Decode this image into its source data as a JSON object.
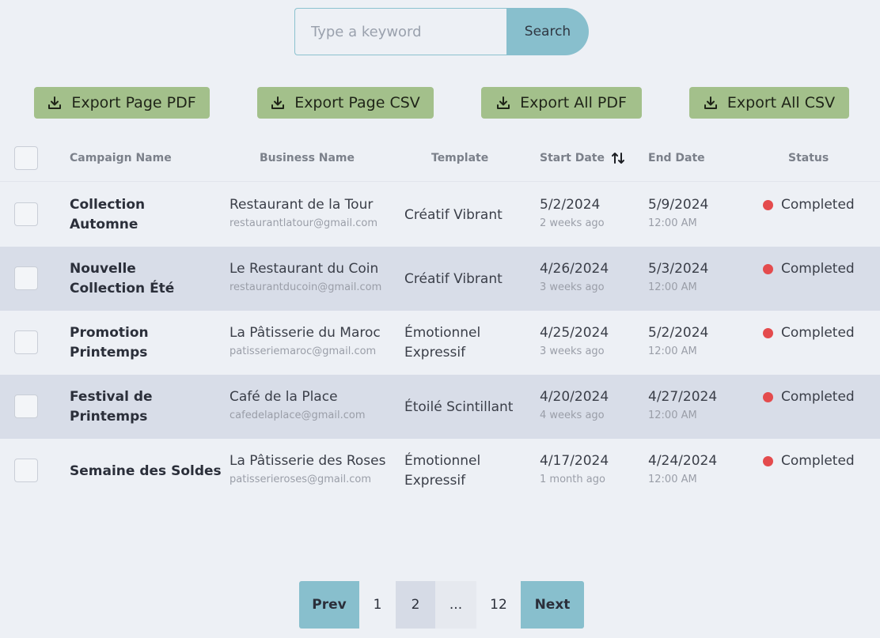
{
  "search": {
    "placeholder": "Type a keyword",
    "value": "",
    "button_label": "Search"
  },
  "exports": [
    {
      "label": "Export Page PDF",
      "icon": "download-icon"
    },
    {
      "label": "Export Page CSV",
      "icon": "download-icon"
    },
    {
      "label": "Export All PDF",
      "icon": "download-icon"
    },
    {
      "label": "Export All CSV",
      "icon": "download-icon"
    }
  ],
  "table": {
    "headers": {
      "campaign": "Campaign Name",
      "business": "Business Name",
      "template": "Template",
      "start": "Start Date",
      "end": "End Date",
      "status": "Status"
    },
    "sort_icon": "sort-arrows-icon",
    "rows": [
      {
        "campaign": "Collection Automne",
        "business": "Restaurant de la Tour",
        "email": "restaurantlatour@gmail.com",
        "template": "Créatif Vibrant",
        "start": "5/2/2024",
        "start_ago": "2 weeks ago",
        "end": "5/9/2024",
        "end_time": "12:00 AM",
        "status": "Completed"
      },
      {
        "campaign": "Nouvelle Collection Été",
        "business": "Le Restaurant du Coin",
        "email": "restaurantducoin@gmail.com",
        "template": "Créatif Vibrant",
        "start": "4/26/2024",
        "start_ago": "3 weeks ago",
        "end": "5/3/2024",
        "end_time": "12:00 AM",
        "status": "Completed"
      },
      {
        "campaign": "Promotion Printemps",
        "business": "La Pâtisserie du Maroc",
        "email": "patisseriemaroc@gmail.com",
        "template": "Émotionnel Expressif",
        "start": "4/25/2024",
        "start_ago": "3 weeks ago",
        "end": "5/2/2024",
        "end_time": "12:00 AM",
        "status": "Completed"
      },
      {
        "campaign": "Festival de Printemps",
        "business": "Café de la Place",
        "email": "cafedelaplace@gmail.com",
        "template": "Étoilé Scintillant",
        "start": "4/20/2024",
        "start_ago": "4 weeks ago",
        "end": "4/27/2024",
        "end_time": "12:00 AM",
        "status": "Completed"
      },
      {
        "campaign": "Semaine des Soldes",
        "business": "La Pâtisserie des Roses",
        "email": "patisserieroses@gmail.com",
        "template": "Émotionnel Expressif",
        "start": "4/17/2024",
        "start_ago": "1 month ago",
        "end": "4/24/2024",
        "end_time": "12:00 AM",
        "status": "Completed"
      }
    ]
  },
  "pagination": {
    "prev": "Prev",
    "pages": [
      "1",
      "2",
      "...",
      "12"
    ],
    "current": "2",
    "next": "Next"
  },
  "colors": {
    "accent": "#88bfcd",
    "export_button": "#a3c08b",
    "status_completed": "#e44b4d",
    "row_shade": "#d8dde8"
  }
}
